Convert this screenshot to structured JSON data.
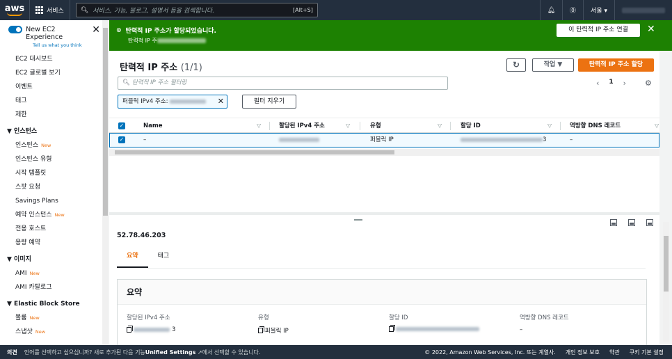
{
  "topnav": {
    "logo": "aws",
    "services_label": "서비스",
    "search_placeholder": "서비스, 기능, 블로그, 설명서 등을 검색합니다.",
    "search_shortcut": "[Alt+S]",
    "region": "서울 ▾"
  },
  "sidebar": {
    "experience_label": "New EC2 Experience",
    "experience_sub": "Tell us what you think",
    "top_items": [
      "EC2 대시보드",
      "EC2 글로벌 보기",
      "이벤트",
      "태그",
      "제한"
    ],
    "sections": [
      {
        "title": "▼ 인스턴스",
        "items": [
          {
            "label": "인스턴스",
            "badge": "New"
          },
          {
            "label": "인스턴스 유형",
            "badge": ""
          },
          {
            "label": "시작 템플릿",
            "badge": ""
          },
          {
            "label": "스팟 요청",
            "badge": ""
          },
          {
            "label": "Savings Plans",
            "badge": ""
          },
          {
            "label": "예약 인스턴스",
            "badge": "New"
          },
          {
            "label": "전용 호스트",
            "badge": ""
          },
          {
            "label": "용량 예약",
            "badge": ""
          }
        ]
      },
      {
        "title": "▼ 이미지",
        "items": [
          {
            "label": "AMI",
            "badge": "New"
          },
          {
            "label": "AMI 카탈로그",
            "badge": ""
          }
        ]
      },
      {
        "title": "▼ Elastic Block Store",
        "items": [
          {
            "label": "볼륨",
            "badge": "New"
          },
          {
            "label": "스냅샷",
            "badge": "New"
          }
        ]
      }
    ]
  },
  "flash": {
    "title": "탄력적 IP 주소가 할당되었습니다.",
    "subtitle_prefix": "탄력적 IP 주",
    "action_label": "이 탄력적 IP 주소 연결",
    "close": "✕"
  },
  "table_panel": {
    "title": "탄력적 IP 주소",
    "count": "(1/1)",
    "refresh": "↻",
    "actions_label": "작업 ▼",
    "primary_label": "탄력적 IP 주소 할당",
    "filter_placeholder": "탄력적 IP 주소 필터링",
    "page": "1",
    "token_label": "퍼블릭 IPv4 주소:",
    "clear_filters": "필터 지우기",
    "columns": [
      "Name",
      "할당된 IPv4 주소",
      "유형",
      "할당 ID",
      "역방향 DNS 레코드"
    ],
    "row": {
      "name": "–",
      "type": "퍼블릭 IP",
      "alloc_suffix": "3",
      "reverse_dns": "–"
    }
  },
  "details": {
    "ip": "52.78.46.203",
    "tabs": [
      "요약",
      "태그"
    ],
    "section_title": "요약",
    "fields": [
      {
        "label": "할당된 IPv4 주소",
        "value": "3"
      },
      {
        "label": "유형",
        "value": "퍼블릭 IP"
      },
      {
        "label": "할당 ID",
        "value": ""
      },
      {
        "label": "역방향 DNS 레코드",
        "value": "–"
      }
    ]
  },
  "footer": {
    "feedback": "의견",
    "message": "언어를 선택하고 싶으십니까? 새로 추가된 다음 기능",
    "message_bold": "Unified Settings",
    "message_end": "에서 선택할 수 있습니다.",
    "copyright": "© 2022, Amazon Web Services, Inc. 또는 계열사.",
    "privacy": "개인 정보 보호",
    "terms": "약관",
    "cookies": "쿠키 기본 설정"
  }
}
